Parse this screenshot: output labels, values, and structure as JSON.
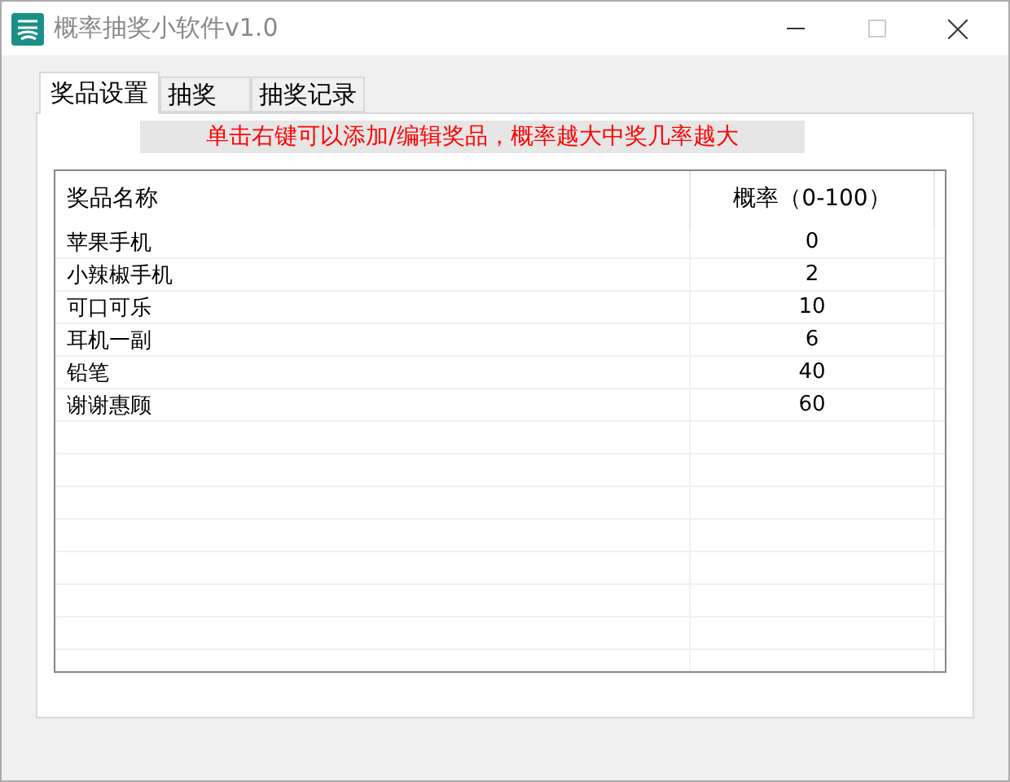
{
  "window": {
    "title": "概率抽奖小软件v1.0",
    "maximize_disabled": true
  },
  "tabs": [
    {
      "label": "奖品设置",
      "selected": true
    },
    {
      "label": "抽奖",
      "selected": false
    },
    {
      "label": "抽奖记录",
      "selected": false
    }
  ],
  "hint": "单击右键可以添加/编辑奖品，概率越大中奖几率越大",
  "table": {
    "columns": [
      "奖品名称",
      "概率（0-100）"
    ],
    "rows": [
      [
        "苹果手机",
        "0"
      ],
      [
        "小辣椒手机",
        "2"
      ],
      [
        "可口可乐",
        "10"
      ],
      [
        "耳机一副",
        "6"
      ],
      [
        "铅笔",
        "40"
      ],
      [
        "谢谢惠顾",
        "60"
      ]
    ]
  }
}
